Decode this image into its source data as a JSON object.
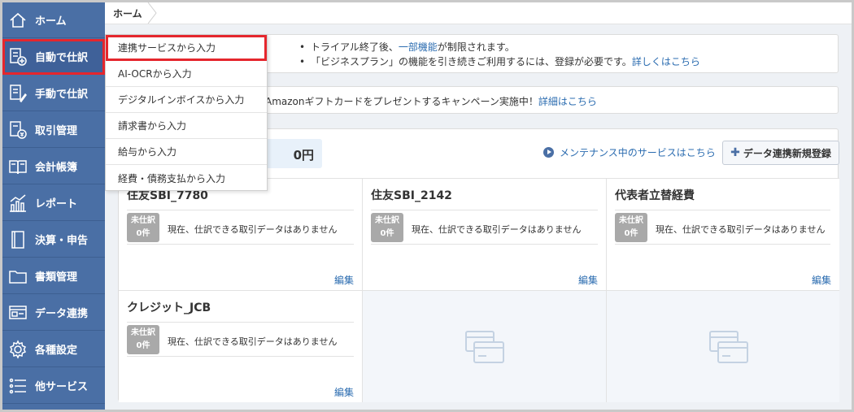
{
  "breadcrumb": {
    "home": "ホーム"
  },
  "sidebar": {
    "items": [
      {
        "label": "ホーム",
        "icon": "home-icon"
      },
      {
        "label": "自動で仕訳",
        "icon": "auto-journal-icon"
      },
      {
        "label": "手動で仕訳",
        "icon": "manual-journal-icon"
      },
      {
        "label": "取引管理",
        "icon": "transaction-icon"
      },
      {
        "label": "会計帳簿",
        "icon": "ledger-book-icon"
      },
      {
        "label": "レポート",
        "icon": "report-chart-icon"
      },
      {
        "label": "決算・申告",
        "icon": "closing-icon"
      },
      {
        "label": "書類管理",
        "icon": "folder-icon"
      },
      {
        "label": "データ連携",
        "icon": "data-link-icon"
      },
      {
        "label": "各種設定",
        "icon": "gear-icon"
      },
      {
        "label": "他サービス",
        "icon": "list-icon"
      }
    ]
  },
  "dropdown": {
    "items": [
      "連携サービスから入力",
      "AI-OCRから入力",
      "デジタルインボイスから入力",
      "請求書から入力",
      "給与から入力",
      "経費・債務支払から入力"
    ]
  },
  "notice": {
    "line1_pre": "トライアル終了後、",
    "line1_link": "一部機能",
    "line1_post": "が制限されます。",
    "line2_pre": "「ビジネスプラン」の機能を引き続きご利用するには、登録が必要です。",
    "line2_link": "詳しくはこちら"
  },
  "campaign": {
    "text": "Amazonギフトカードをプレゼントするキャンペーン実施中！",
    "link": "詳細はこちら"
  },
  "panel": {
    "total": "0円",
    "maintenance_link": "メンテナンス中のサービスはこちら",
    "add_button": "データ連携新規登録"
  },
  "accounts": [
    {
      "name": "住友SBI_7780",
      "badge_line1": "未仕訳",
      "badge_line2": "0件",
      "status": "現在、仕訳できる取引データはありません",
      "edit": "編集"
    },
    {
      "name": "住友SBI_2142",
      "badge_line1": "未仕訳",
      "badge_line2": "0件",
      "status": "現在、仕訳できる取引データはありません",
      "edit": "編集"
    },
    {
      "name": "代表者立替経費",
      "badge_line1": "未仕訳",
      "badge_line2": "0件",
      "status": "現在、仕訳できる取引データはありません",
      "edit": "編集"
    },
    {
      "name": "クレジット_JCB",
      "badge_line1": "未仕訳",
      "badge_line2": "0件",
      "status": "現在、仕訳できる取引データはありません",
      "edit": "編集"
    }
  ],
  "colors": {
    "sidebar": "#4a6fa5",
    "highlight": "#e5262d",
    "link": "#2b6cb0"
  }
}
